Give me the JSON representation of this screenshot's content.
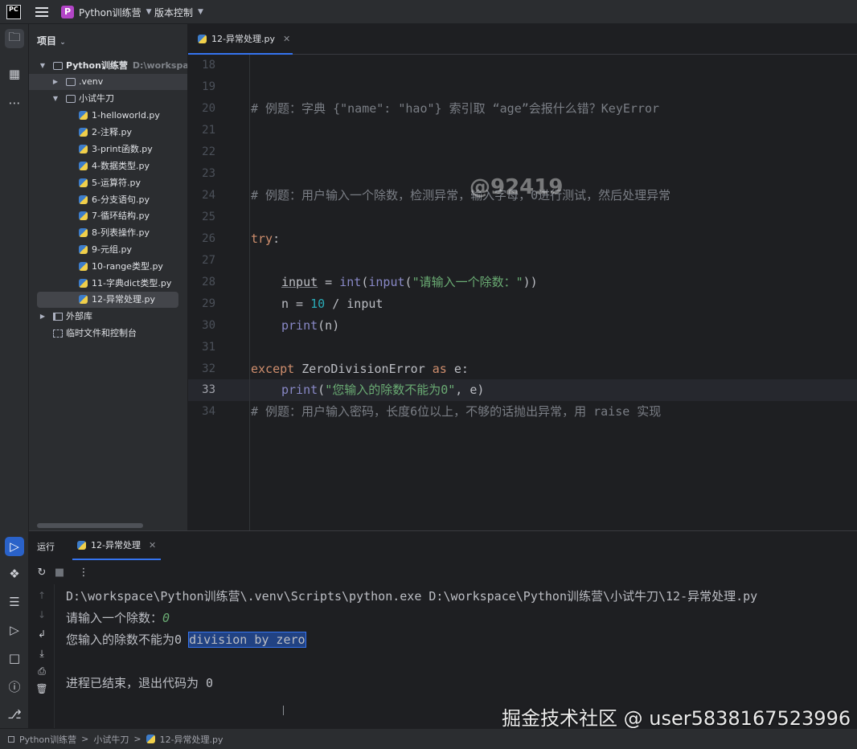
{
  "titlebar": {
    "app_logo": "PC",
    "project_badge": "P",
    "project_name": "Python训练营",
    "vcs_label": "版本控制"
  },
  "project_panel": {
    "header": "项目",
    "items": [
      {
        "label": "Python训练营",
        "path": "D:\\workspace\\F"
      },
      {
        "label": ".venv"
      },
      {
        "label": "小试牛刀"
      },
      {
        "label": "1-helloworld.py"
      },
      {
        "label": "2-注释.py"
      },
      {
        "label": "3-print函数.py"
      },
      {
        "label": "4-数据类型.py"
      },
      {
        "label": "5-运算符.py"
      },
      {
        "label": "6-分支语句.py"
      },
      {
        "label": "7-循环结构.py"
      },
      {
        "label": "8-列表操作.py"
      },
      {
        "label": "9-元组.py"
      },
      {
        "label": "10-range类型.py"
      },
      {
        "label": "11-字典dict类型.py"
      },
      {
        "label": "12-异常处理.py"
      },
      {
        "label": "外部库"
      },
      {
        "label": "临时文件和控制台"
      }
    ]
  },
  "editor": {
    "tab_label": "12-异常处理.py",
    "line_numbers": [
      "18",
      "19",
      "20",
      "21",
      "22",
      "23",
      "24",
      "25",
      "26",
      "27",
      "28",
      "29",
      "30",
      "31",
      "32",
      "33",
      "34"
    ],
    "current_line": "33",
    "code": {
      "l20": "# 例题：字典 {\"name\": \"hao\"} 索引取 “age”会报什么错？KeyError",
      "l24": "# 例题：用户输入一个除数，检测异常，输入字母，0进行测试，然后处理异常",
      "l26_kw": "try",
      "l26_colon": ":",
      "l28_var": "input",
      "l28_eq": " = ",
      "l28_int": "int",
      "l28_p1": "(",
      "l28_input": "input",
      "l28_p2": "(",
      "l28_str": "\"请输入一个除数：\"",
      "l28_p3": "))",
      "l29_a": "n = ",
      "l29_num": "10",
      "l29_b": " / input",
      "l30_print": "print",
      "l30_rest": "(n)",
      "l32_kw": "except",
      "l32_exc": " ZeroDivisionError ",
      "l32_as": "as",
      "l32_rest": " e:",
      "l33_print": "print",
      "l33_p1": "(",
      "l33_str": "\"您输入的除数不能为0\"",
      "l33_rest": ", e)",
      "l34": "# 例题：用户输入密码，长度6位以上，不够的话抛出异常，用 raise 实现"
    },
    "watermark_id": "@92419"
  },
  "run_panel": {
    "title": "运行",
    "tab_label": "12-异常处理",
    "console": {
      "cmd": "D:\\workspace\\Python训练营\\.venv\\Scripts\\python.exe D:\\workspace\\Python训练营\\小试牛刀\\12-异常处理.py",
      "prompt": "请输入一个除数：",
      "input_value": "0",
      "error_prefix": "您输入的除数不能为0 ",
      "error_selected": "division by zero",
      "exit_line": "进程已结束，退出代码为 0"
    }
  },
  "statusbar": {
    "crumb1": "Python训练营",
    "sep": ">",
    "crumb2": "小试牛刀",
    "crumb3": "12-异常处理.py"
  },
  "site_watermark": "掘金技术社区 @ user5838167523996"
}
